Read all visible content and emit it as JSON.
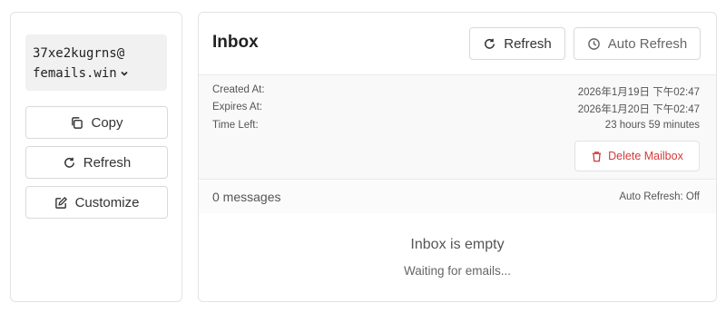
{
  "sidebar": {
    "email_line1": "37xe2kugrns@",
    "email_line2": "femails.win",
    "copy_label": "Copy",
    "refresh_label": "Refresh",
    "customize_label": "Customize"
  },
  "inbox": {
    "title": "Inbox",
    "refresh_label": "Refresh",
    "auto_refresh_label": "Auto Refresh",
    "created_label": "Created At:",
    "created_value": "2026年1月19日 下午02:47",
    "expires_label": "Expires At:",
    "expires_value": "2026年1月20日 下午02:47",
    "time_left_label": "Time Left:",
    "time_left_value": "23 hours 59 minutes",
    "delete_label": "Delete Mailbox",
    "message_count": "0 messages",
    "auto_refresh_status": "Auto Refresh: Off",
    "empty_title": "Inbox is empty",
    "empty_subtitle": "Waiting for emails..."
  },
  "colors": {
    "danger": "#d33a3a",
    "email_bg": "#f1f1f1",
    "border": "#d9d9d9"
  },
  "icons": [
    "chevron-down-icon",
    "copy-icon",
    "refresh-icon",
    "edit-icon",
    "clock-icon",
    "trash-icon"
  ]
}
